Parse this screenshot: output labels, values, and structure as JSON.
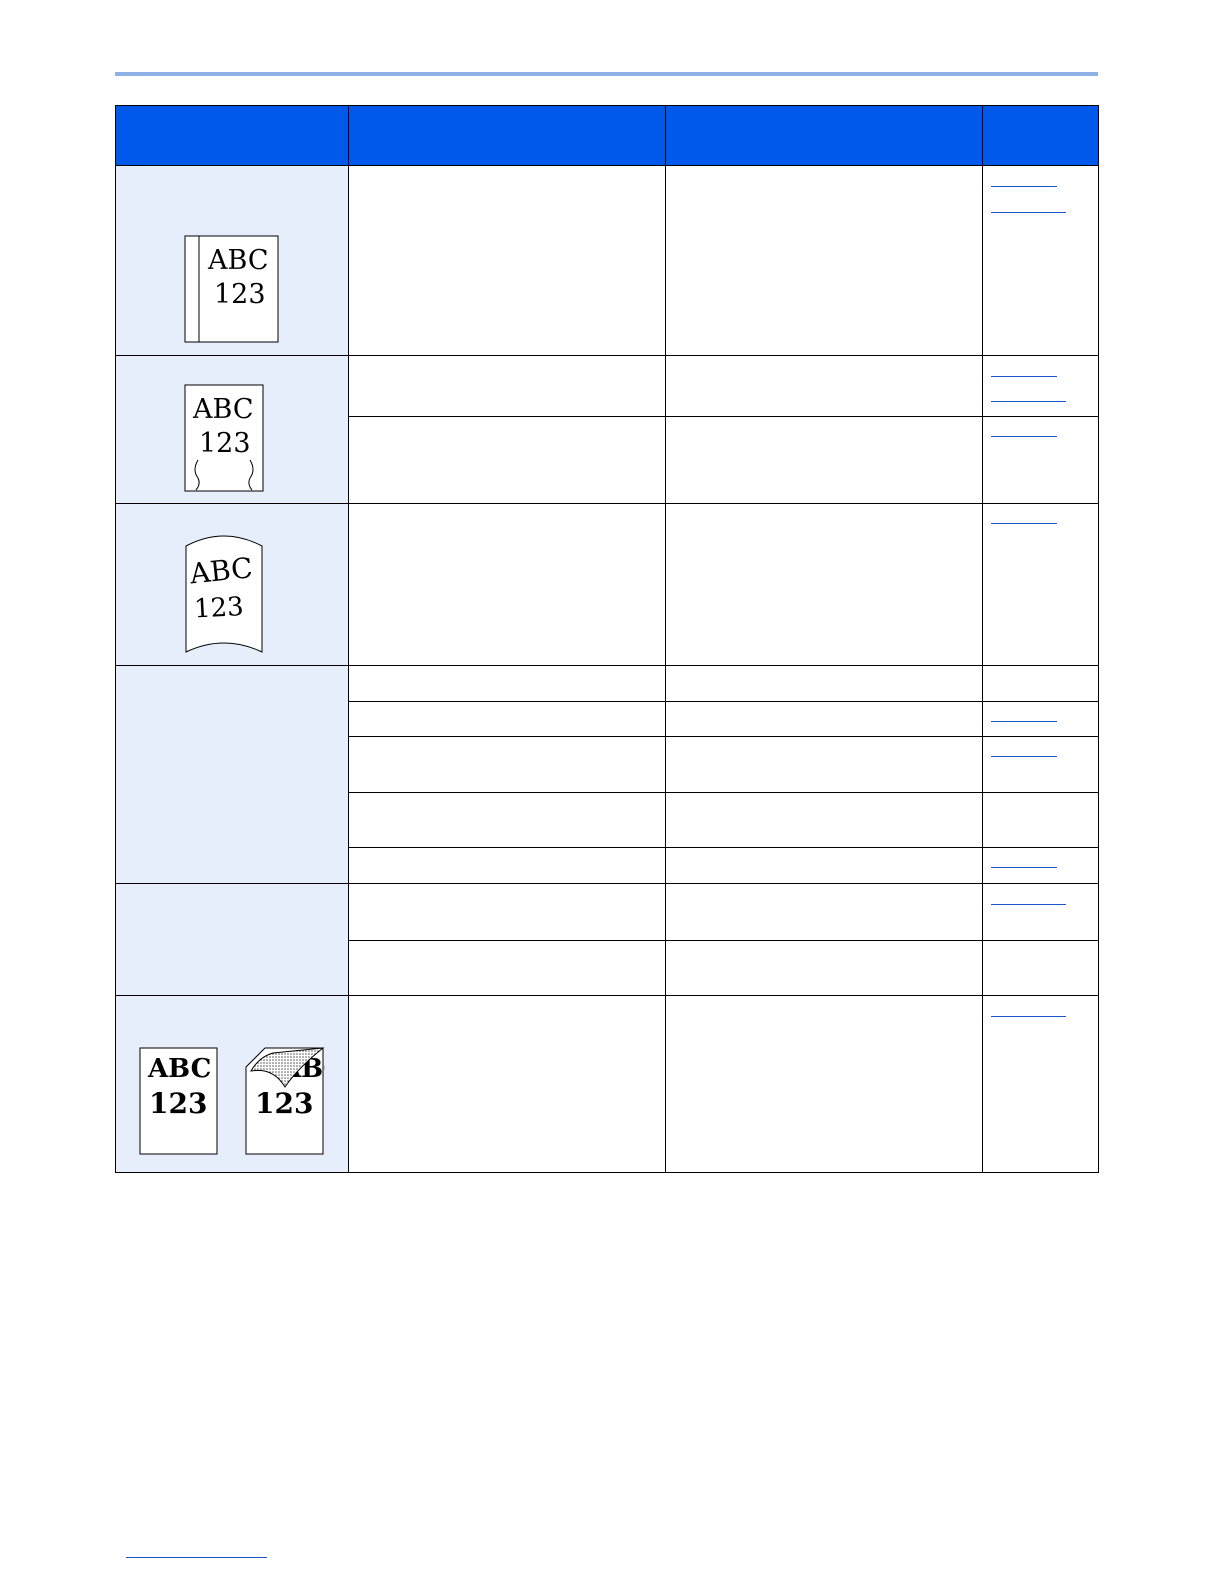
{
  "header": {
    "columns": [
      "",
      "",
      "",
      ""
    ],
    "background_color": "#0059eb"
  },
  "colors": {
    "symptom_cell": "#e6edfb",
    "link": "#1a56c9",
    "top_rule": "#8db0e6"
  },
  "illustrations": [
    {
      "name": "page-with-margin-line",
      "line1": "ABC",
      "line2": "123"
    },
    {
      "name": "page-with-wavy-edges",
      "line1": "ABC",
      "line2": "123"
    },
    {
      "name": "curled-page",
      "line1": "ABC",
      "line2": "123"
    },
    {
      "name": "normal-page",
      "line1": "ABC",
      "line2": "123"
    },
    {
      "name": "smudged-corner-page",
      "line1": "ABC",
      "line2": "123"
    }
  ]
}
